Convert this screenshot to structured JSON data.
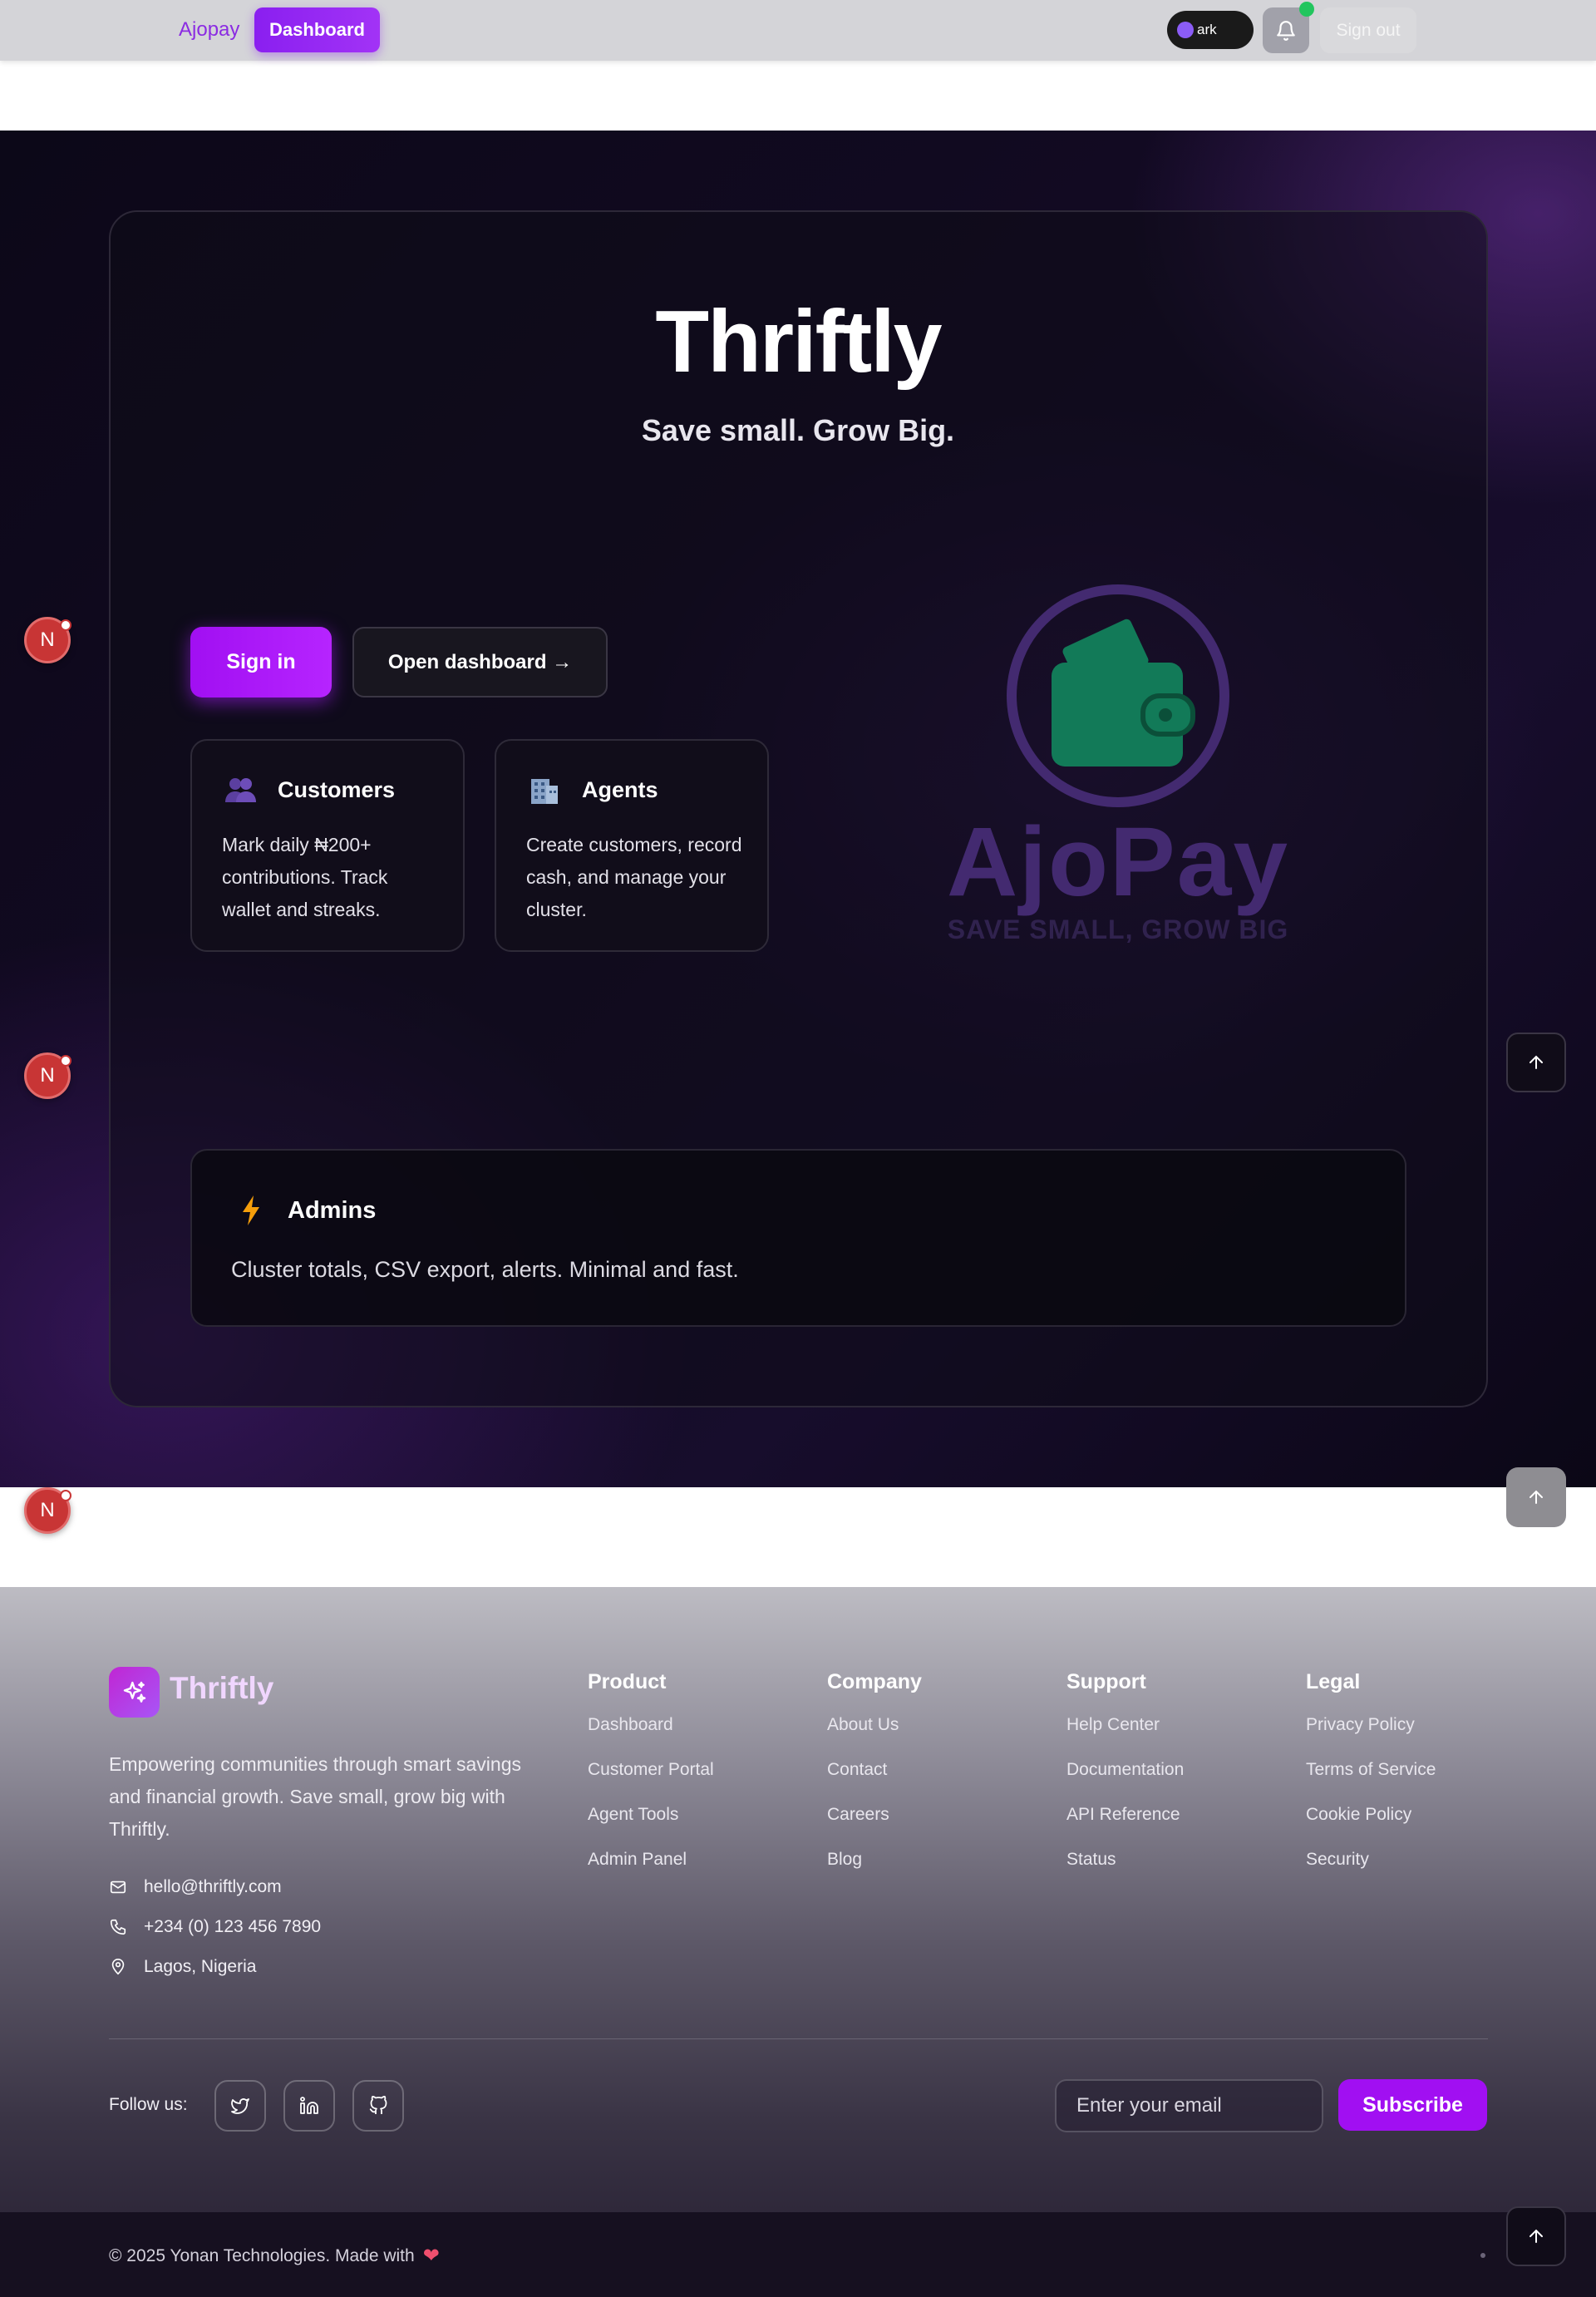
{
  "header": {
    "brand_label": "Ajopay",
    "dashboard_label": "Dashboard",
    "theme_label": "ark",
    "signout_label": "Sign out",
    "colors": {
      "accent": "#8b2be2",
      "notification": "#22c55e"
    }
  },
  "hero": {
    "title": "Thriftly",
    "tagline": "Save small. Grow Big.",
    "signin_label": "Sign in",
    "open_dashboard_label": "Open dashboard →",
    "features": [
      {
        "icon": "people-icon",
        "title": "Customers",
        "description": "Mark daily ₦200+ contributions. Track wallet and streaks."
      },
      {
        "icon": "office-building-icon",
        "title": "Agents",
        "description": "Create customers, record cash, and manage your cluster."
      }
    ],
    "logo": {
      "wordmark": "AjoPay",
      "tagline": "SAVE SMALL, GROW BIG"
    },
    "admins": {
      "icon": "lightning-icon",
      "title": "Admins",
      "description": "Cluster totals, CSV export, alerts. Minimal and fast."
    }
  },
  "floating": {
    "next_badge_label": "N"
  },
  "footer": {
    "brand": "Thriftly",
    "about": "Empowering communities through smart savings and financial growth. Save small, grow big with Thriftly.",
    "contact": {
      "email": "hello@thriftly.com",
      "phone": "+234 (0) 123 456 7890",
      "location": "Lagos, Nigeria"
    },
    "columns": [
      {
        "title": "Product",
        "links": [
          "Dashboard",
          "Customer Portal",
          "Agent Tools",
          "Admin Panel"
        ]
      },
      {
        "title": "Company",
        "links": [
          "About Us",
          "Contact",
          "Careers",
          "Blog"
        ]
      },
      {
        "title": "Support",
        "links": [
          "Help Center",
          "Documentation",
          "API Reference",
          "Status"
        ]
      },
      {
        "title": "Legal",
        "links": [
          "Privacy Policy",
          "Terms of Service",
          "Cookie Policy",
          "Security"
        ]
      }
    ],
    "follow_label": "Follow us:",
    "social": [
      "twitter-icon",
      "linkedin-icon",
      "github-icon"
    ],
    "email_placeholder": "Enter your email",
    "subscribe_label": "Subscribe",
    "copyright": "© 2025 Yonan Technologies. Made with",
    "heart": "❤"
  }
}
